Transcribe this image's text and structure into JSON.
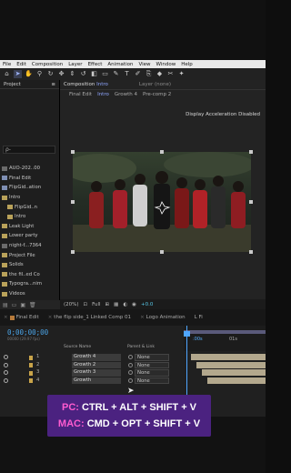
{
  "menu": [
    "File",
    "Edit",
    "Composition",
    "Layer",
    "Effect",
    "Animation",
    "View",
    "Window",
    "Help"
  ],
  "toolbar_icons": [
    "home-icon",
    "selection-icon",
    "hand-icon",
    "zoom-icon",
    "orbit-icon",
    "pan-icon",
    "dolly-icon",
    "rotate-icon",
    "camera-icon",
    "mask-icon",
    "pen-icon",
    "type-icon",
    "brush-icon",
    "clone-icon",
    "eraser-icon",
    "roto-icon",
    "puppet-icon"
  ],
  "project": {
    "tab_label": "Project",
    "search_placeholder": "ρ-",
    "items": [
      {
        "name": "AUO-202..00",
        "kind": "file"
      },
      {
        "name": "Final Edit",
        "kind": "comp"
      },
      {
        "name": "FlipGid..ation",
        "kind": "comp"
      },
      {
        "name": "Intro",
        "kind": "folder"
      },
      {
        "name": "FlipGid..n",
        "kind": "folder"
      },
      {
        "name": "Intro",
        "kind": "folder"
      },
      {
        "name": "Leak Light",
        "kind": "folder"
      },
      {
        "name": "Lower party",
        "kind": "folder"
      },
      {
        "name": "night-f...7364",
        "kind": "file"
      },
      {
        "name": "Project File",
        "kind": "folder"
      },
      {
        "name": "Solids",
        "kind": "folder"
      },
      {
        "name": "the fil..ed Co",
        "kind": "folder"
      },
      {
        "name": "Typogra...nim",
        "kind": "folder"
      },
      {
        "name": "Videos",
        "kind": "folder"
      }
    ]
  },
  "composition": {
    "tab_prefix": "Composition",
    "tab_name": "Intro",
    "layer_label": "Layer (none)",
    "breadcrumbs": [
      "Final Edit",
      "Intro",
      "Growth 4",
      "Pre-comp 2"
    ],
    "status": "Display Acceleration Disabled",
    "zoom": "(20%)",
    "resolution": "Full",
    "exposure": "+0.0"
  },
  "timeline": {
    "tabs": [
      "Final Edit",
      "the flip side_1 Linked Comp 01",
      "Logo Animation",
      "L Fi"
    ],
    "timecode": "0;00;00;00",
    "timecode_sub": "00000 (29.97 fps)",
    "search_placeholder": "ρ-",
    "header_source": "Source Name",
    "header_parent": "Parent & Link",
    "ruler_start": ":00s",
    "ruler_next": "01s",
    "layers": [
      {
        "num": "1",
        "name": "Growth 4",
        "parent": "None",
        "color": "#c9a44a"
      },
      {
        "num": "2",
        "name": "Growth 2",
        "parent": "None",
        "color": "#c9a44a"
      },
      {
        "num": "3",
        "name": "Growth 3",
        "parent": "None",
        "color": "#c9a44a"
      },
      {
        "num": "4",
        "name": "Growth",
        "parent": "None",
        "color": "#c9a44a"
      }
    ]
  },
  "caption": {
    "pc_label": "PC:",
    "pc_keys": "CTRL + ALT + SHIFT + V",
    "mac_label": "MAC:",
    "mac_keys": "CMD + OPT + SHIFT + V"
  }
}
